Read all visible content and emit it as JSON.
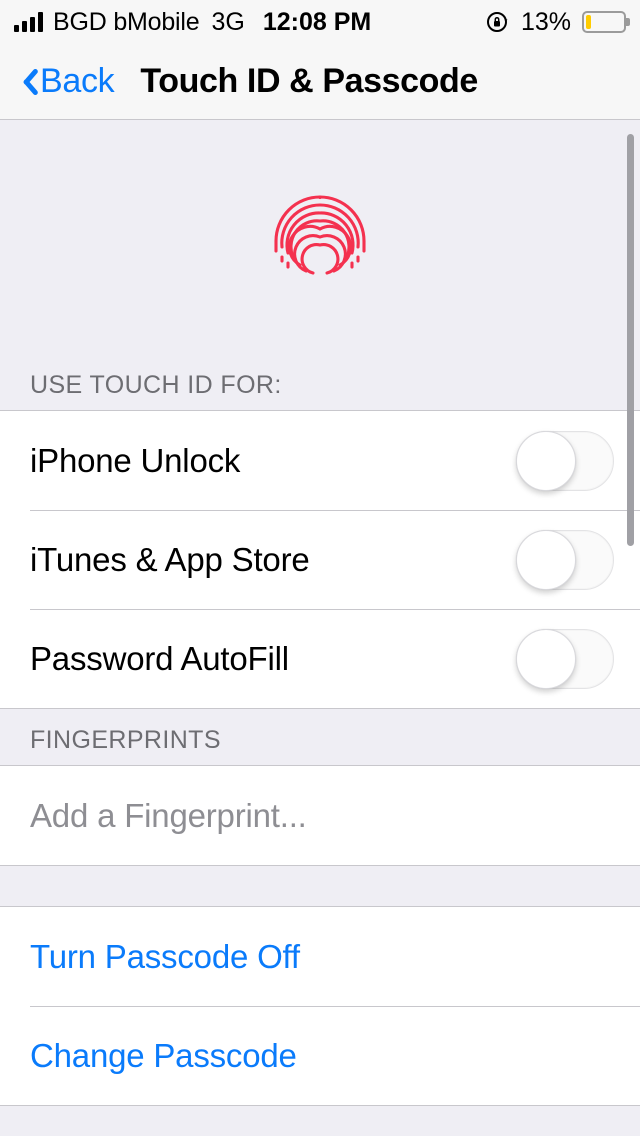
{
  "status_bar": {
    "signal_bars": 4,
    "carrier": "BGD bMobile",
    "network_type": "3G",
    "time": "12:08 PM",
    "rotation_lock_icon": "rotation-lock-icon",
    "battery_percent": "13%",
    "battery_level": 13,
    "battery_color": "#FFCC00"
  },
  "nav": {
    "back_label": "Back",
    "back_icon": "chevron-left-icon",
    "title": "Touch ID & Passcode"
  },
  "hero": {
    "icon": "fingerprint-icon",
    "icon_color": "#F4314F"
  },
  "sections": [
    {
      "header": "USE TOUCH ID FOR:",
      "rows": [
        {
          "label": "iPhone Unlock",
          "type": "toggle",
          "value": false
        },
        {
          "label": "iTunes & App Store",
          "type": "toggle",
          "value": false
        },
        {
          "label": "Password AutoFill",
          "type": "toggle",
          "value": false
        }
      ]
    },
    {
      "header": "FINGERPRINTS",
      "rows": [
        {
          "label": "Add a Fingerprint...",
          "type": "muted"
        }
      ]
    },
    {
      "header": "",
      "rows": [
        {
          "label": "Turn Passcode Off",
          "type": "link"
        },
        {
          "label": "Change Passcode",
          "type": "link"
        }
      ]
    }
  ],
  "colors": {
    "tint_blue": "#0a7bfb",
    "group_background": "#EFEEF4",
    "cell_background": "#FFFFFF",
    "separator": "#c8c7cc",
    "header_text": "#6d6d72"
  }
}
